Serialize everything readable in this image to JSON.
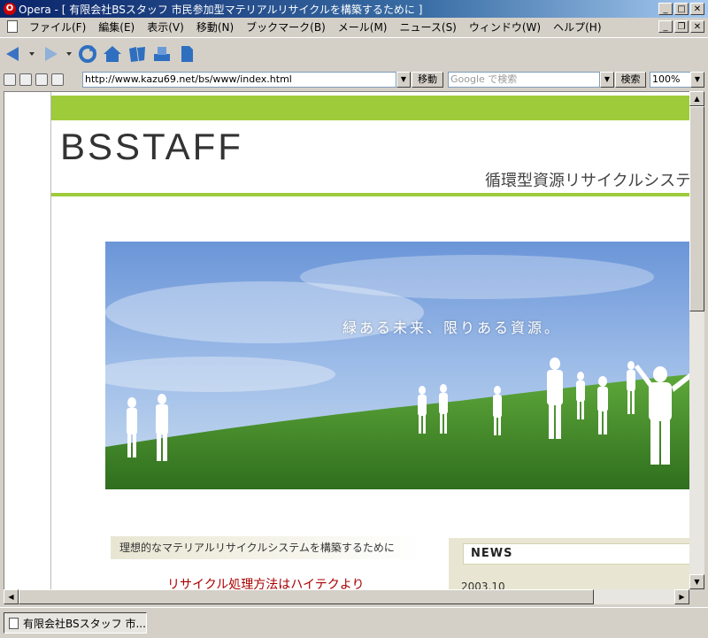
{
  "window": {
    "title": "Opera - [ 有限会社BSスタッフ 市民参加型マテリアルリサイクルを構築するために ]",
    "icon": "opera-icon"
  },
  "menu": {
    "items": [
      "ファイル(F)",
      "編集(E)",
      "表示(V)",
      "移動(N)",
      "ブックマーク(B)",
      "メール(M)",
      "ニュース(S)",
      "ウィンドウ(W)",
      "ヘルプ(H)"
    ]
  },
  "toolbar": {
    "buttons": [
      "back-icon",
      "back-menu-icon",
      "forward-icon",
      "forward-menu-icon",
      "reload-icon",
      "home-icon",
      "hotlist-icon",
      "print-icon",
      "new-page-icon"
    ]
  },
  "address": {
    "url": "http://www.kazu69.net/bs/www/index.html",
    "go_label": "移動",
    "search_placeholder": "Google で検索",
    "search_button": "検索",
    "zoom": "100%"
  },
  "page": {
    "logo": "BSSTAFF",
    "tagline": "循環型資源リサイクルシステ",
    "hero_caption": "緑ある未来、限りある資源。",
    "section_heading": "理想的なマテリアルリサイクルシステムを構築するために",
    "red_heading": "リサイクル処理方法はハイテクより",
    "news_title": "NEWS",
    "news_date": "2003.10"
  },
  "taskbar": {
    "tab_label": "有限会社BSスタッフ 市..."
  },
  "colors": {
    "brand_green": "#9dcb3a",
    "title_blue": "#0a246a",
    "heading_red": "#a00000"
  }
}
